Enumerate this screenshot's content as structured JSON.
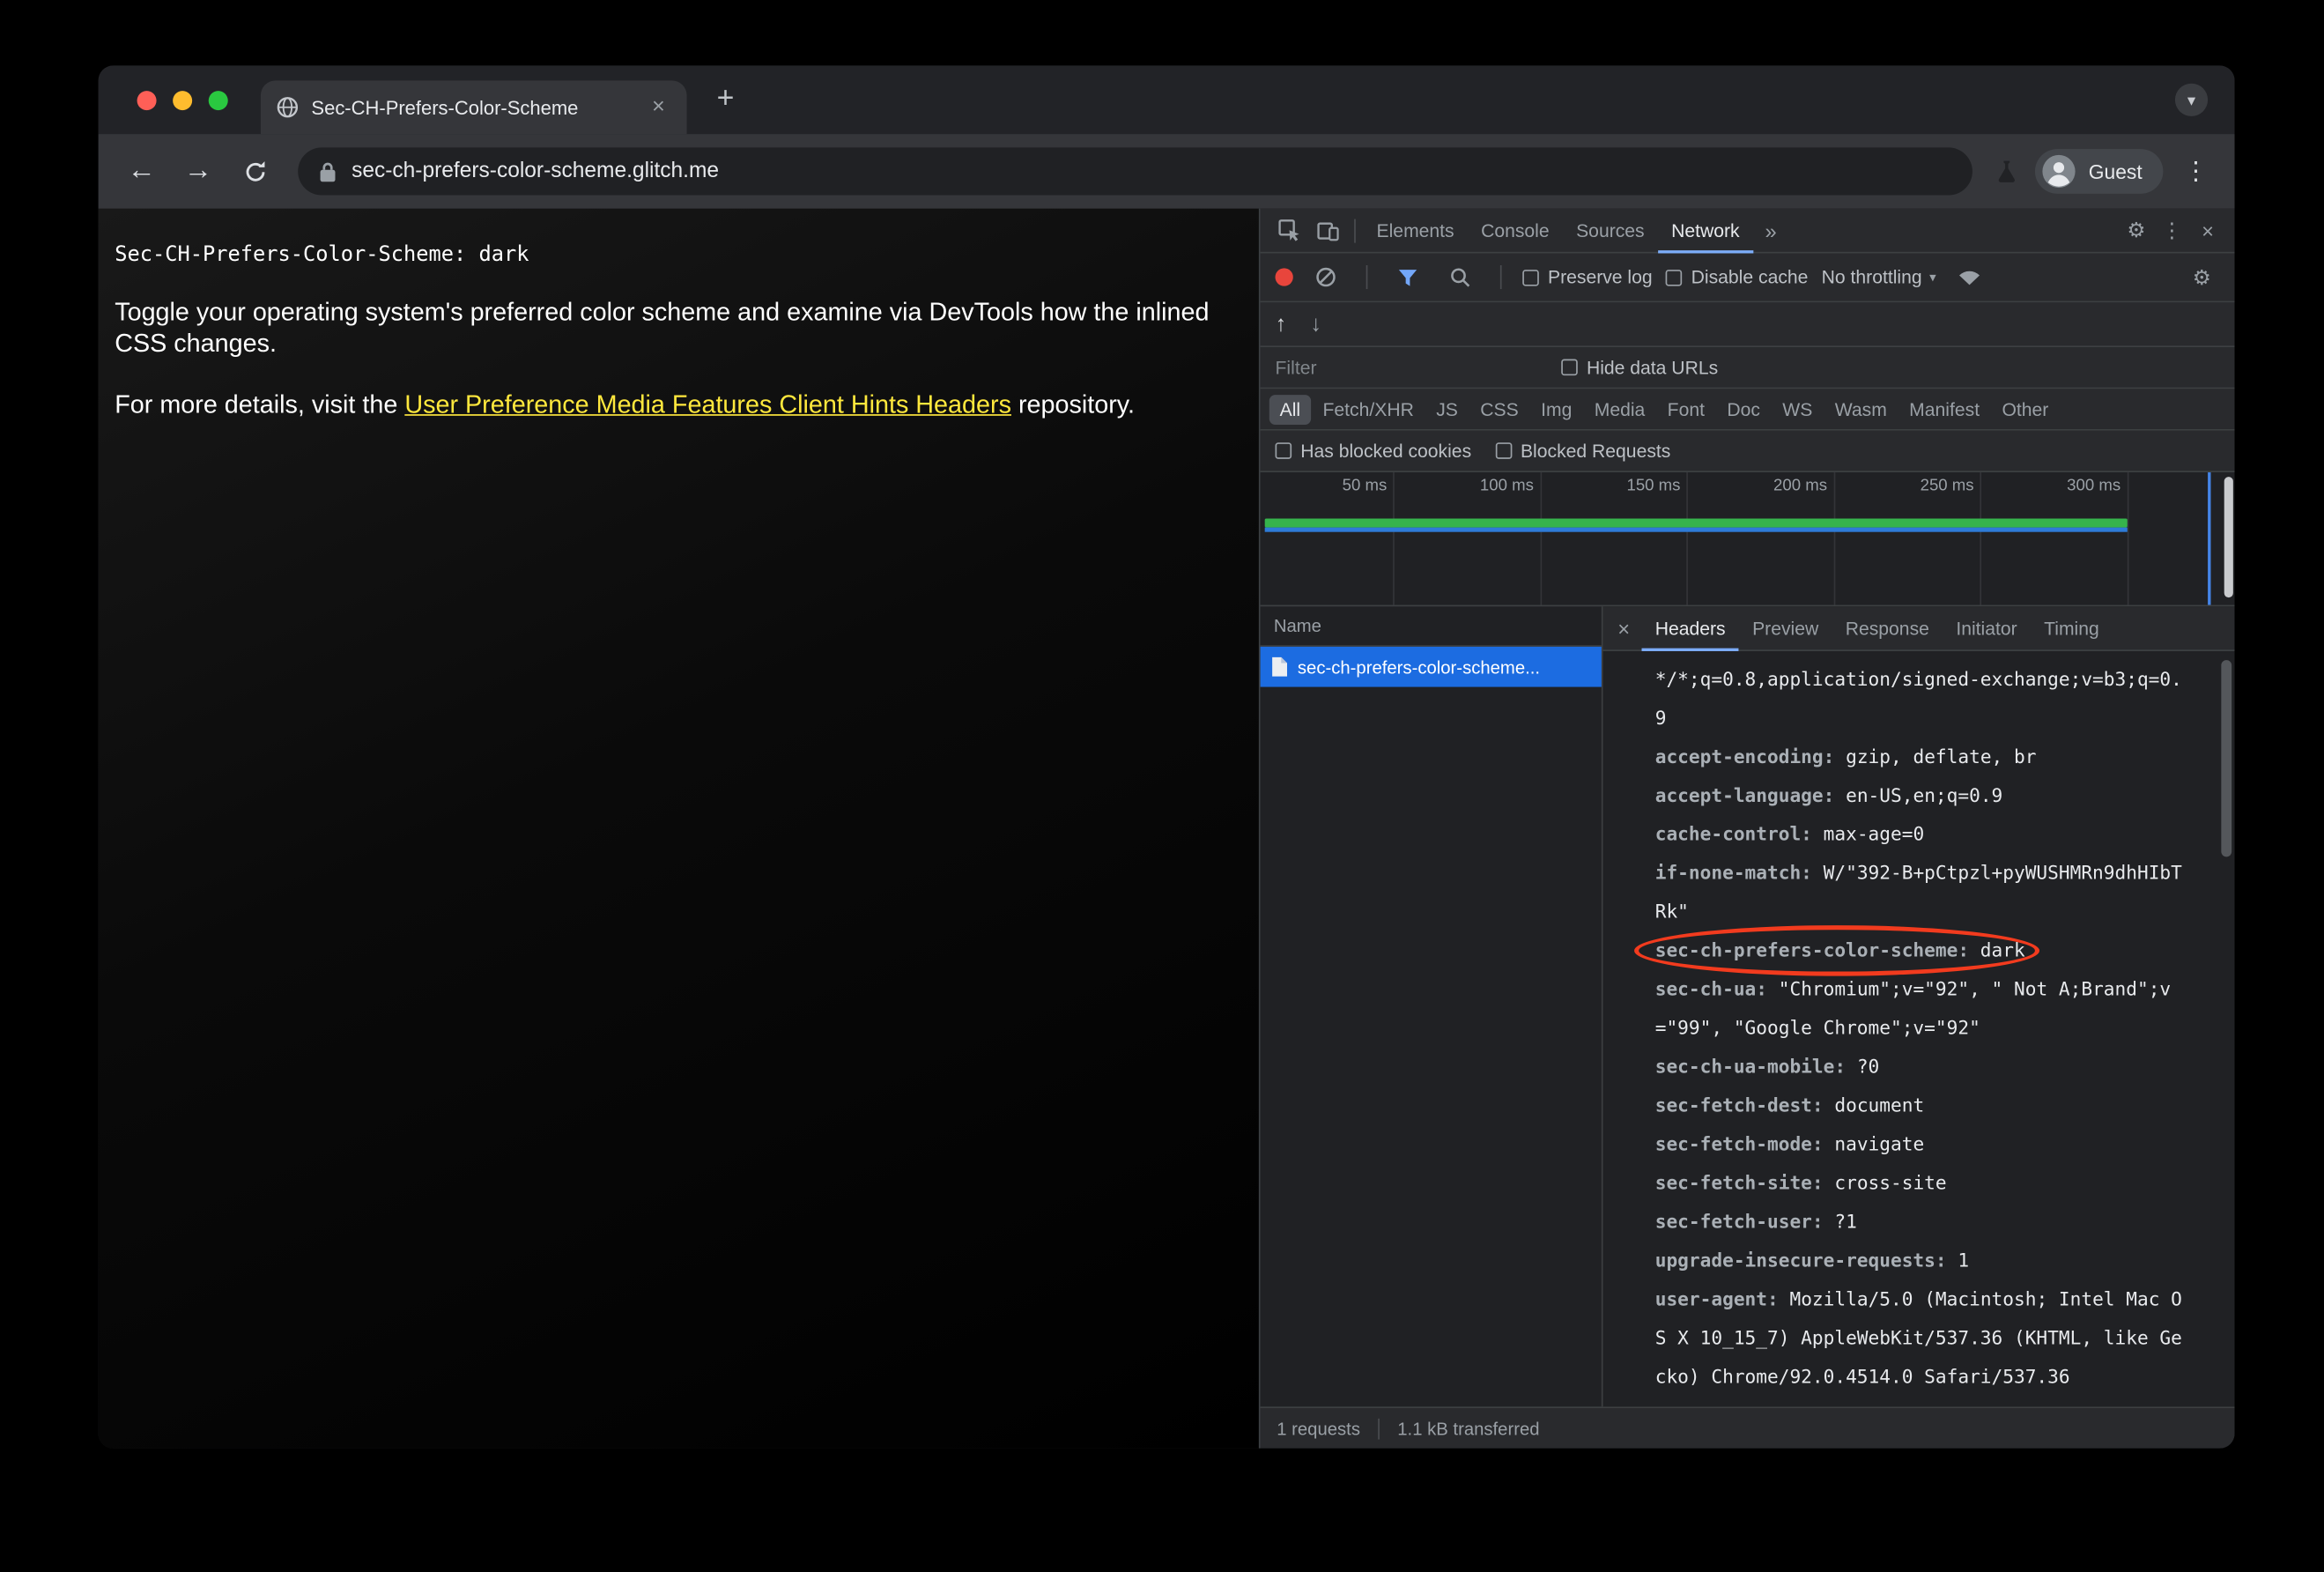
{
  "colors": {
    "accent_blue": "#7cacf8",
    "selection_blue": "#1c6ce1",
    "link_yellow": "#ffe83d",
    "record_red": "#e8453c",
    "annotation_red": "#f23b1e",
    "bar_green": "#36b44c",
    "bar_blue": "#2e7bd8",
    "event_blue": "#4585e8"
  },
  "icons": {
    "back": "←",
    "forward": "→",
    "plus": "+",
    "close": "×",
    "kebab": "⋮",
    "gear": "⚙",
    "more_tabs": "»",
    "chevron_down": "▾",
    "up_arrow": "↑",
    "down_arrow": "↓"
  },
  "window": {
    "tab": {
      "title": "Sec-CH-Prefers-Color-Scheme"
    },
    "address": {
      "url": "sec-ch-prefers-color-scheme.glitch.me"
    },
    "profile": {
      "label": "Guest"
    }
  },
  "page": {
    "header_line": "Sec-CH-Prefers-Color-Scheme: dark",
    "para1": "Toggle your operating system's preferred color scheme and examine via DevTools how the inlined CSS changes.",
    "para2_before": "For more details, visit the ",
    "para2_link": "User Preference Media Features Client Hints Headers",
    "para2_after": " repository."
  },
  "devtools": {
    "tabs": [
      "Elements",
      "Console",
      "Sources",
      "Network"
    ],
    "active_tab": "Network",
    "controls": {
      "preserve_log": "Preserve log",
      "disable_cache": "Disable cache",
      "throttling": "No throttling"
    },
    "filter": {
      "placeholder": "Filter",
      "hide_data_urls": "Hide data URLs"
    },
    "type_filters": [
      "All",
      "Fetch/XHR",
      "JS",
      "CSS",
      "Img",
      "Media",
      "Font",
      "Doc",
      "WS",
      "Wasm",
      "Manifest",
      "Other"
    ],
    "active_type_filter": "All",
    "blocked": {
      "cookies": "Has blocked cookies",
      "requests": "Blocked Requests"
    },
    "timeline": {
      "ticks": [
        "50 ms",
        "100 ms",
        "150 ms",
        "200 ms",
        "250 ms",
        "300 ms"
      ]
    },
    "requests": {
      "name_header": "Name",
      "rows": [
        {
          "name": "sec-ch-prefers-color-scheme...",
          "selected": true
        }
      ]
    },
    "detail_tabs": [
      "Headers",
      "Preview",
      "Response",
      "Initiator",
      "Timing"
    ],
    "active_detail_tab": "Headers",
    "request_headers": [
      {
        "name": "",
        "value": "*/*;q=0.8,application/signed-exchange;v=b3;q=0.9"
      },
      {
        "name": "accept-encoding:",
        "value": "gzip, deflate, br"
      },
      {
        "name": "accept-language:",
        "value": "en-US,en;q=0.9"
      },
      {
        "name": "cache-control:",
        "value": "max-age=0"
      },
      {
        "name": "if-none-match:",
        "value": "W/\"392-B+pCtpzl+pyWUSHMRn9dhHIbTRk\""
      },
      {
        "name": "sec-ch-prefers-color-scheme:",
        "value": "dark",
        "circled": true
      },
      {
        "name": "sec-ch-ua:",
        "value": "\"Chromium\";v=\"92\", \" Not A;Brand\";v=\"99\", \"Google Chrome\";v=\"92\""
      },
      {
        "name": "sec-ch-ua-mobile:",
        "value": "?0"
      },
      {
        "name": "sec-fetch-dest:",
        "value": "document"
      },
      {
        "name": "sec-fetch-mode:",
        "value": "navigate"
      },
      {
        "name": "sec-fetch-site:",
        "value": "cross-site"
      },
      {
        "name": "sec-fetch-user:",
        "value": "?1"
      },
      {
        "name": "upgrade-insecure-requests:",
        "value": "1"
      },
      {
        "name": "user-agent:",
        "value": "Mozilla/5.0 (Macintosh; Intel Mac OS X 10_15_7) AppleWebKit/537.36 (KHTML, like Gecko) Chrome/92.0.4514.0 Safari/537.36"
      }
    ],
    "status": {
      "requests": "1 requests",
      "transferred": "1.1 kB transferred"
    }
  }
}
